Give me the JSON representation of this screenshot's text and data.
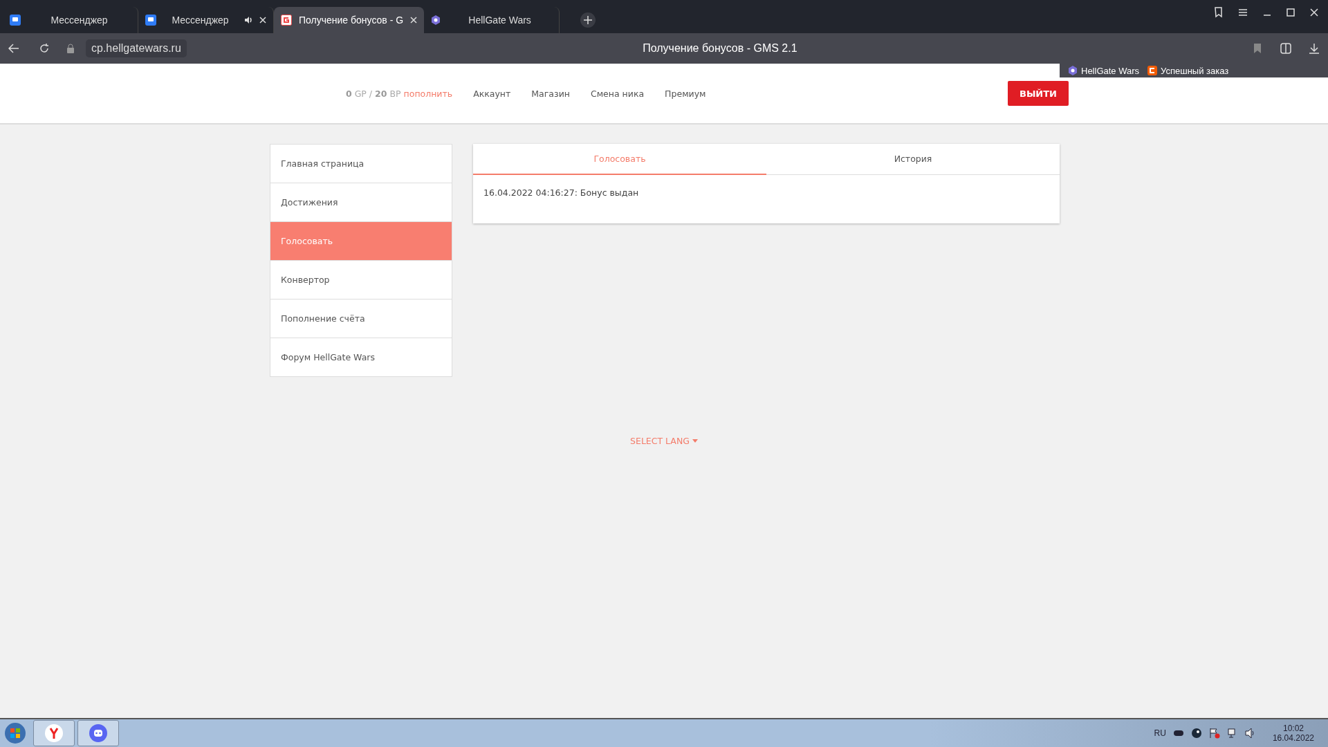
{
  "browser": {
    "tabs": [
      {
        "title": "Мессенджер",
        "selected": false,
        "audio": false,
        "closable": false
      },
      {
        "title": "Мессенджер",
        "selected": false,
        "audio": true,
        "closable": true
      },
      {
        "title": "Получение бонусов - G",
        "selected": true,
        "audio": false,
        "closable": true
      },
      {
        "title": "HellGate Wars",
        "selected": false,
        "audio": false,
        "closable": false
      }
    ],
    "address": "cp.hellgatewars.ru",
    "page_title": "Получение бонусов - GMS 2.1",
    "bookmarks": [
      {
        "title": "HellGate Wars"
      },
      {
        "title": "Успешный заказ"
      }
    ]
  },
  "header": {
    "balance": "**0** GP / **20** BP",
    "topup_link": "пополнить",
    "nav": [
      "Аккаунт",
      "Магазин",
      "Смена ника",
      "Премиум"
    ],
    "logout": "ВЫЙТИ"
  },
  "sidebar": {
    "items": [
      {
        "label": "Главная страница",
        "selected": false
      },
      {
        "label": "Достижения",
        "selected": false
      },
      {
        "label": "Голосовать",
        "selected": true
      },
      {
        "label": "Конвертор",
        "selected": false
      },
      {
        "label": "Пополнение счёта",
        "selected": false
      },
      {
        "label": "Форум HellGate Wars",
        "selected": false
      }
    ]
  },
  "panel": {
    "tabs": [
      {
        "label": "Голосовать",
        "selected": true
      },
      {
        "label": "История",
        "selected": false
      }
    ],
    "entries": [
      "16.04.2022 04:16:27: Бонус выдан"
    ]
  },
  "footer": {
    "lang_select": "SELECT LANG"
  },
  "taskbar": {
    "apps": [
      {
        "kind": "yandex"
      },
      {
        "kind": "discord"
      }
    ],
    "language": "RU",
    "time": "10:02",
    "date": "16.04.2022"
  }
}
